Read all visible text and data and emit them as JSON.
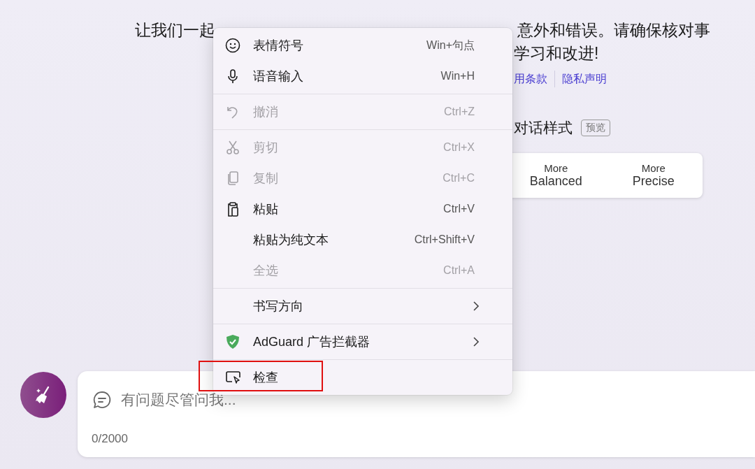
{
  "intro": {
    "line1_left": "让我们一起",
    "line1_right": "意外和错误。请确保核对事",
    "line2": "学习和改进!",
    "links": [
      "用条款",
      "隐私声明"
    ]
  },
  "style_picker": {
    "heading": "对话样式",
    "badge": "预览",
    "options": [
      {
        "top": "More",
        "bottom": "Balanced"
      },
      {
        "top": "More",
        "bottom": "Precise"
      }
    ]
  },
  "context_menu": [
    {
      "kind": "item",
      "label": "表情符号",
      "shortcut": "Win+句点",
      "disabled": false,
      "submenu": false,
      "highlighted": false
    },
    {
      "kind": "item",
      "label": "语音输入",
      "shortcut": "Win+H",
      "disabled": false,
      "submenu": false,
      "highlighted": false
    },
    {
      "kind": "separator"
    },
    {
      "kind": "item",
      "label": "撤消",
      "shortcut": "Ctrl+Z",
      "disabled": true,
      "submenu": false,
      "highlighted": false
    },
    {
      "kind": "separator"
    },
    {
      "kind": "item",
      "label": "剪切",
      "shortcut": "Ctrl+X",
      "disabled": true,
      "submenu": false,
      "highlighted": false
    },
    {
      "kind": "item",
      "label": "复制",
      "shortcut": "Ctrl+C",
      "disabled": true,
      "submenu": false,
      "highlighted": false
    },
    {
      "kind": "item",
      "label": "粘贴",
      "shortcut": "Ctrl+V",
      "disabled": false,
      "submenu": false,
      "highlighted": false
    },
    {
      "kind": "item",
      "label": "粘贴为纯文本",
      "shortcut": "Ctrl+Shift+V",
      "disabled": false,
      "submenu": false,
      "highlighted": false
    },
    {
      "kind": "item",
      "label": "全选",
      "shortcut": "Ctrl+A",
      "disabled": true,
      "submenu": false,
      "highlighted": false
    },
    {
      "kind": "separator"
    },
    {
      "kind": "item",
      "label": "书写方向",
      "disabled": false,
      "submenu": true,
      "highlighted": false
    },
    {
      "kind": "separator"
    },
    {
      "kind": "item",
      "label": "AdGuard 广告拦截器",
      "disabled": false,
      "submenu": true,
      "highlighted": false
    },
    {
      "kind": "separator"
    },
    {
      "kind": "item",
      "label": "检查",
      "disabled": false,
      "submenu": false,
      "highlighted": true
    }
  ],
  "composer": {
    "placeholder": "有问题尽管问我...",
    "counter": "0/2000"
  }
}
